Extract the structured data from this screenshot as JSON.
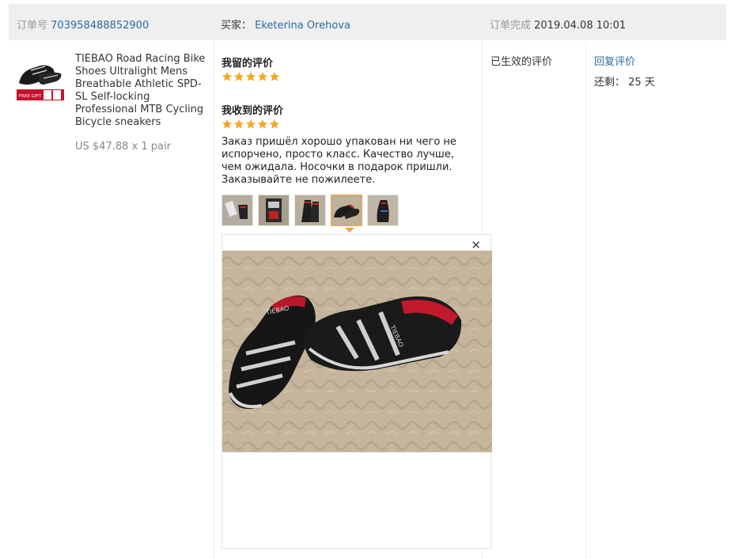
{
  "header": {
    "order_label": "订单号",
    "order_number": "703958488852900",
    "buyer_label": "买家：",
    "buyer_name": "Eketerina Orehova",
    "completed_label": "订单完成",
    "completed_time": "2019.04.08 10:01"
  },
  "product": {
    "title": "TIEBAO Road Racing Bike Shoes Ultralight Mens Breathable Athletic SPD-SL Self-locking Professional MTB Cycling Bicycle sneakers",
    "price": "US $47.88 x 1 pair",
    "image_badge": "FREE GIFT"
  },
  "my_review": {
    "title": "我留的评价",
    "stars": 5
  },
  "received_review": {
    "title": "我收到的评价",
    "stars": 5,
    "text": "Заказ пришёл хорошо упакован ни чего не испорчено, просто класс. Качество лучше, чем ожидала. Носочки в подарок пришли. Заказывайте не пожилеете.",
    "thumbnail_count": 5,
    "selected_thumbnail": 4
  },
  "preview": {
    "close_symbol": "✕",
    "shoe_brand": "TIEBAO"
  },
  "status": {
    "label": "已生效的评价"
  },
  "actions": {
    "reply_label": "回复评价",
    "remaining_label": "还剩：",
    "remaining_value": "25 天"
  },
  "colors": {
    "link": "#2c6aa0",
    "star": "#f5a623",
    "thumb_active": "#f1a23c",
    "header_bg": "#efefef"
  },
  "icons": [
    "star-icon",
    "close-icon"
  ]
}
